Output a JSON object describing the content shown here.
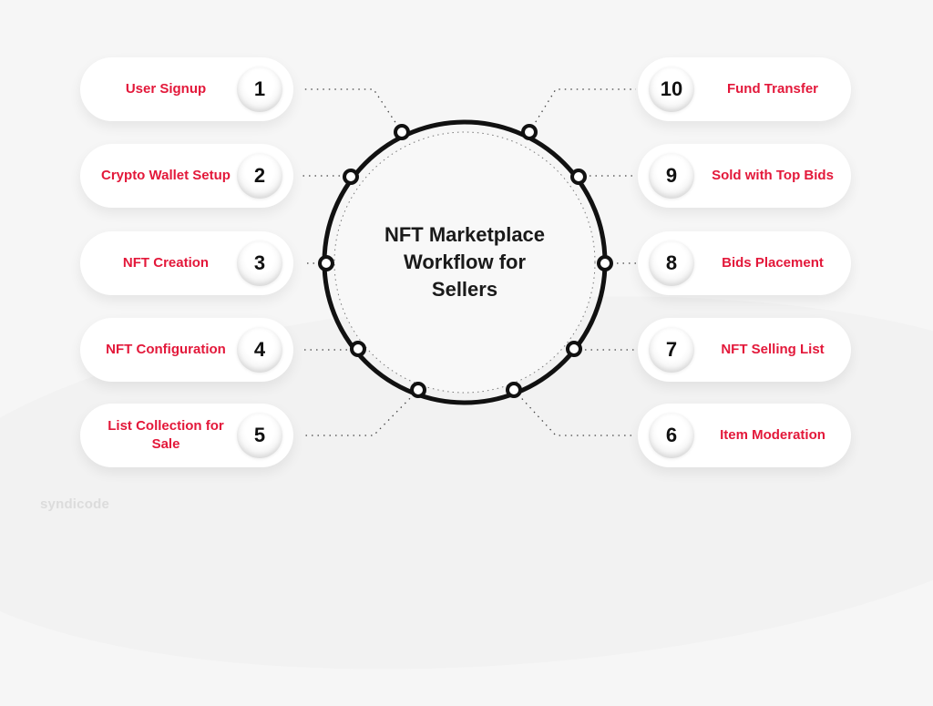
{
  "title": "NFT Marketplace Workflow for Sellers",
  "title_lines": [
    "NFT Marketplace",
    "Workflow for",
    "Sellers"
  ],
  "accent_color": "#e3183a",
  "logo": "syndicode",
  "steps": [
    {
      "num": "1",
      "label": "User Signup"
    },
    {
      "num": "2",
      "label": "Crypto Wallet Setup"
    },
    {
      "num": "3",
      "label": "NFT Creation"
    },
    {
      "num": "4",
      "label": "NFT Configuration"
    },
    {
      "num": "5",
      "label": "List Collection for Sale"
    },
    {
      "num": "6",
      "label": "Item Moderation"
    },
    {
      "num": "7",
      "label": "NFT Selling List"
    },
    {
      "num": "8",
      "label": "Bids Placement"
    },
    {
      "num": "9",
      "label": "Sold with Top Bids"
    },
    {
      "num": "10",
      "label": "Fund Transfer"
    }
  ]
}
